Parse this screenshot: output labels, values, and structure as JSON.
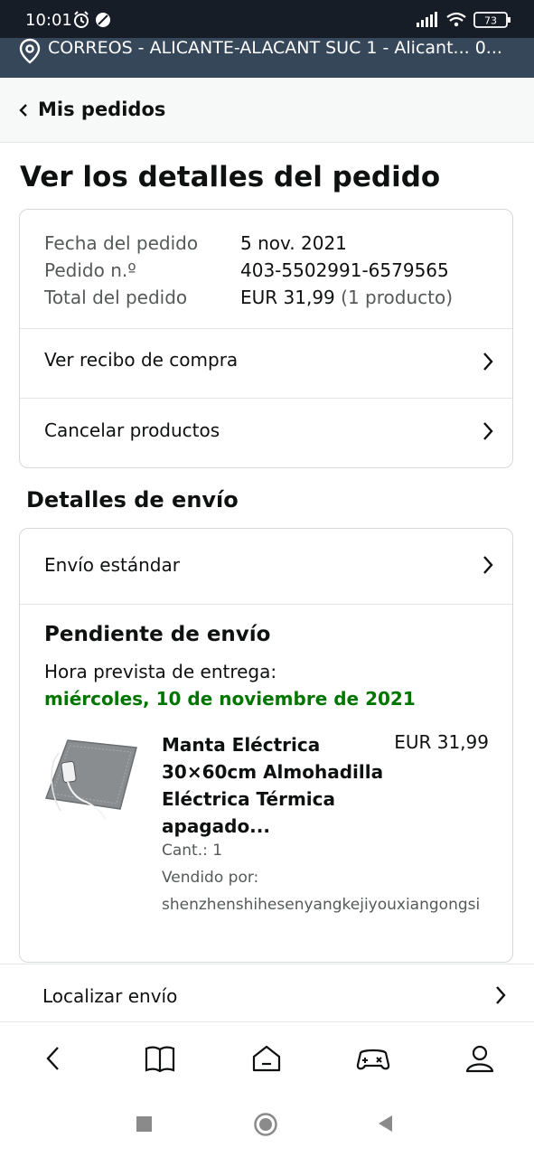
{
  "status_bar": {
    "time": "10:01",
    "battery": "73"
  },
  "location_bar": {
    "text": "CORREOS - ALICANTE-ALACANT SUC 1 - Alicant... 0..."
  },
  "back_nav": {
    "label": "Mis pedidos"
  },
  "page_title": "Ver los detalles del pedido",
  "order_summary": {
    "date_label": "Fecha del pedido",
    "date_value": "5 nov. 2021",
    "number_label": "Pedido n.º",
    "number_value": "403-5502991-6579565",
    "total_label": "Total del pedido",
    "total_value": "EUR 31,99",
    "total_count": "(1 producto)",
    "receipt_link": "Ver recibo de compra",
    "cancel_link": "Cancelar productos"
  },
  "shipping": {
    "section_title": "Detalles de envío",
    "method": "Envío estándar",
    "status": "Pendiente de envío",
    "eta_label": "Hora prevista de entrega:",
    "eta_date": "miércoles, 10 de noviembre de 2021",
    "product": {
      "name_lines": [
        "Manta Eléctrica",
        "30×60cm Almohadilla",
        "Eléctrica Térmica",
        "apagado..."
      ],
      "price": "EUR 31,99",
      "qty": "Cant.: 1",
      "seller_label": "Vendido por:",
      "seller": "shenzhenshihesenyangkejiyouxiangongsi"
    },
    "track_link": "Localizar envío"
  },
  "bottom_nav": {
    "items": [
      "back-icon",
      "book-icon",
      "home-icon",
      "gamepad-icon",
      "account-icon"
    ]
  },
  "colors": {
    "status_bar_bg": "#161d26",
    "location_bar_bg": "#37475a",
    "eta_green": "#007600",
    "text_primary": "#0f1111",
    "text_secondary": "#565959"
  }
}
